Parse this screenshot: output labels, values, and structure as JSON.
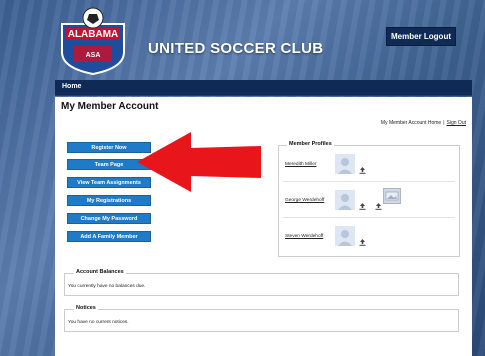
{
  "header": {
    "logo_text": "ALABAMA",
    "logo_subtext": "ASA",
    "club_name": "UNITED SOCCER CLUB",
    "logout_label": "Member Logout"
  },
  "nav": {
    "home_label": "Home"
  },
  "account": {
    "title": "My Member Account",
    "home_link": "My Member Account Home",
    "separator": "|",
    "signout_link": "Sign Out"
  },
  "actions": [
    {
      "label": "Register Now"
    },
    {
      "label": "Team Page"
    },
    {
      "label": "View Team Assignments"
    },
    {
      "label": "My Registrations"
    },
    {
      "label": "Change My Password"
    },
    {
      "label": "Add A Family Member"
    }
  ],
  "profiles": {
    "legend": "Member Profiles",
    "members": [
      {
        "name": "Meredith Miller"
      },
      {
        "name": "George Werdehoff"
      },
      {
        "name": "Steven Werdehoff"
      }
    ]
  },
  "balances": {
    "legend": "Account Balances",
    "message": "You currently have no balances due."
  },
  "notices": {
    "legend": "Notices",
    "message": "You have no current notices."
  },
  "colors": {
    "navy": "#0f2a55",
    "button_blue": "#1f7ac8",
    "arrow_red": "#e8151b"
  }
}
